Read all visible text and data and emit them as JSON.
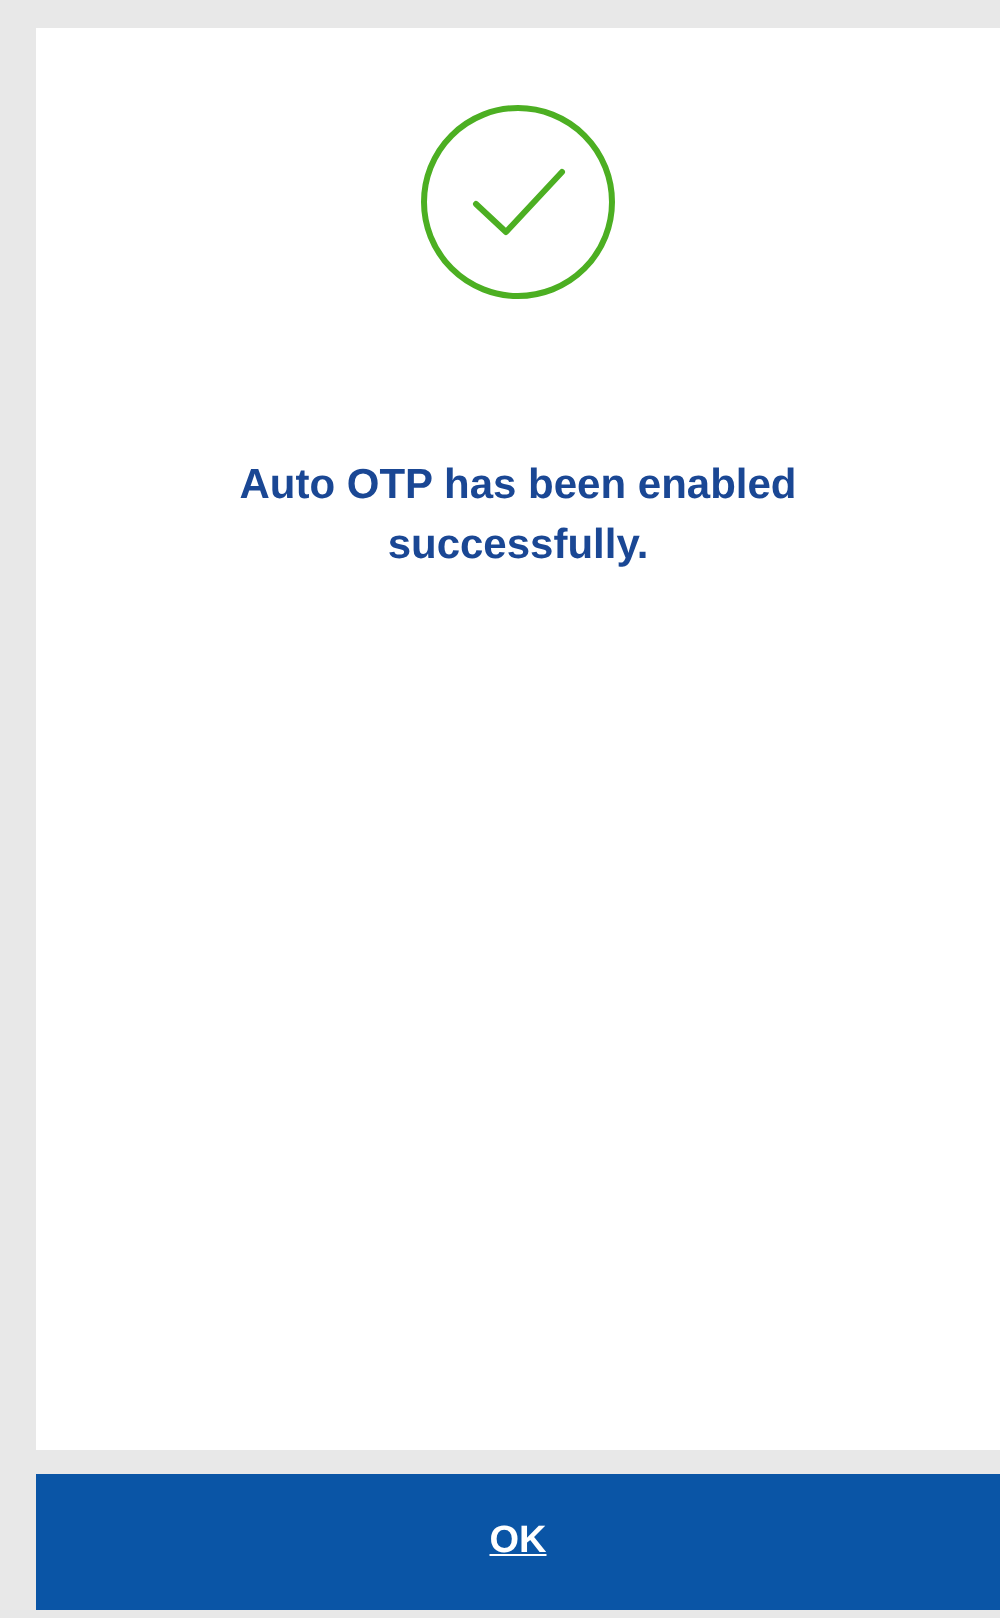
{
  "message": "Auto OTP has been enabled successfully.",
  "button": {
    "label": "OK"
  }
}
